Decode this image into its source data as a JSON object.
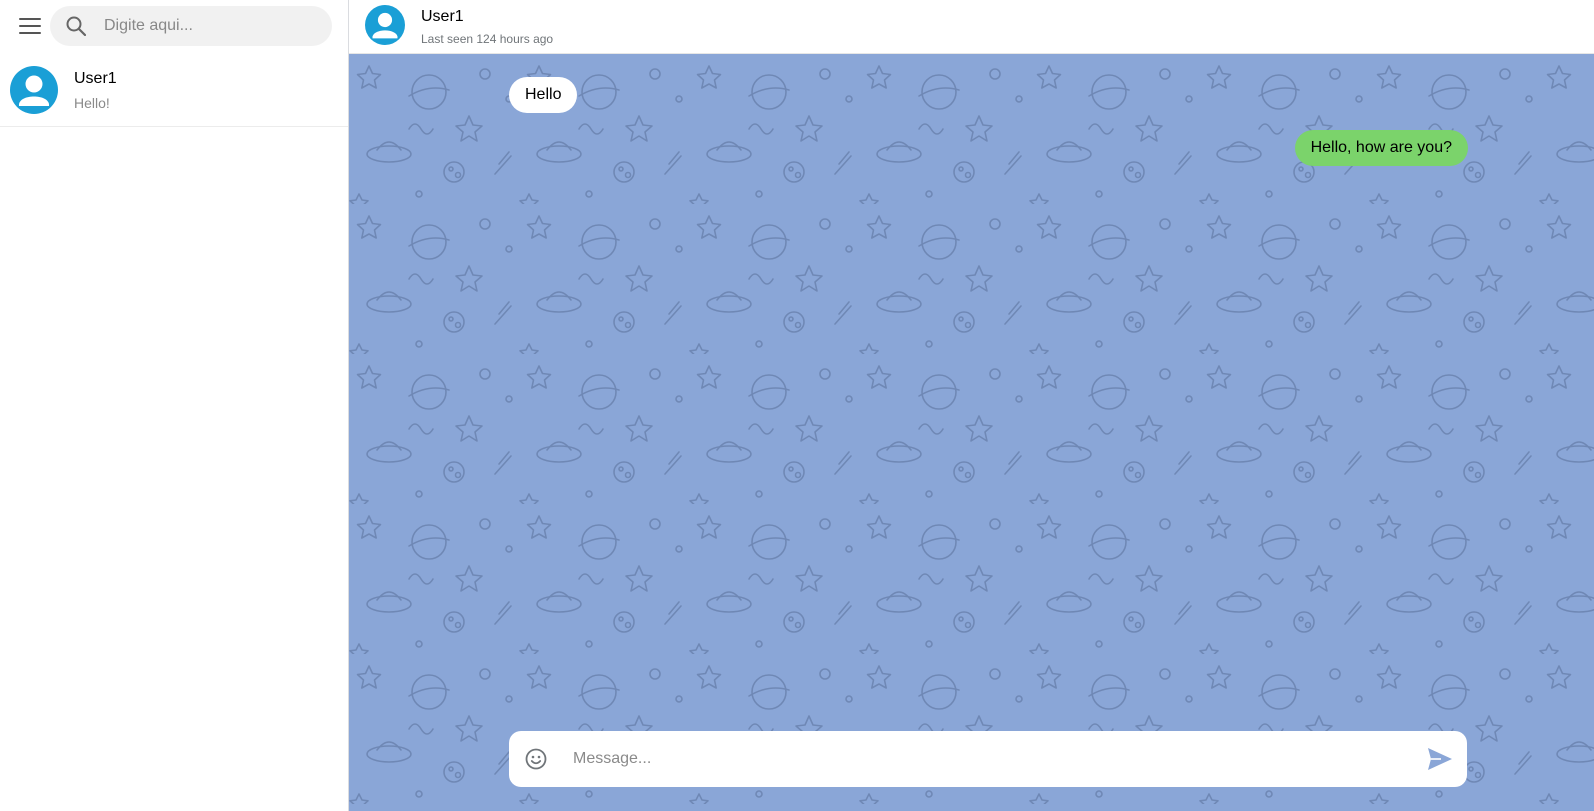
{
  "sidebar": {
    "search": {
      "placeholder": "Digite aqui..."
    },
    "chats": [
      {
        "name": "User1",
        "preview": "Hello!"
      }
    ]
  },
  "header": {
    "name": "User1",
    "status": "Last seen 124 hours ago"
  },
  "messages": [
    {
      "direction": "incoming",
      "text": "Hello"
    },
    {
      "direction": "outgoing",
      "text": "Hello, how are you?"
    }
  ],
  "composer": {
    "placeholder": "Message..."
  },
  "colors": {
    "accent": "#1a9fd6",
    "chat_background": "#8aa6d7",
    "outgoing_bubble": "#7bd36b",
    "incoming_bubble": "#ffffff",
    "send_icon": "#8aa6d7"
  },
  "icons": [
    "menu-icon",
    "search-icon",
    "avatar-icon",
    "emoji-icon",
    "send-icon"
  ]
}
